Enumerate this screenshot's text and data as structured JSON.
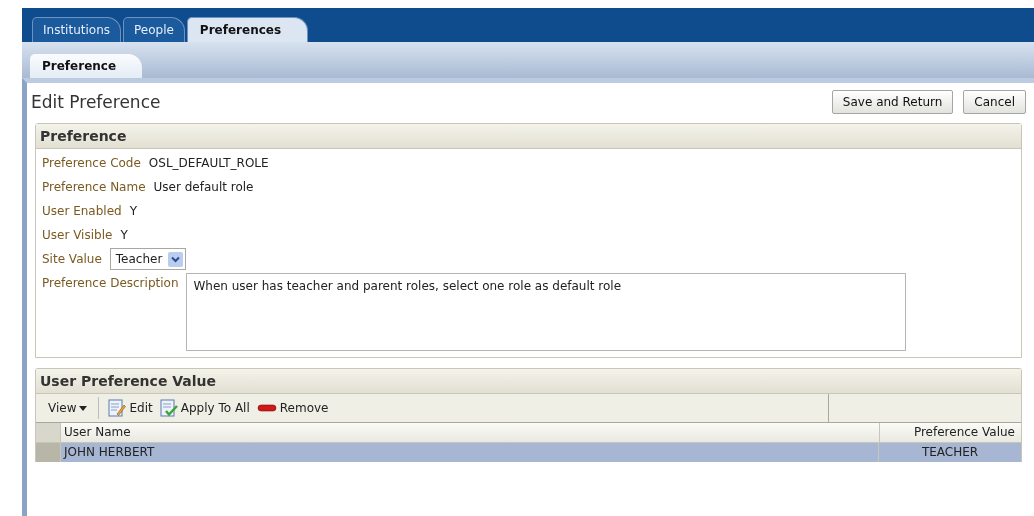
{
  "tabs": [
    {
      "label": "Institutions",
      "selected": false
    },
    {
      "label": "People",
      "selected": false
    },
    {
      "label": "Preferences",
      "selected": true
    }
  ],
  "subtabs": [
    {
      "label": "Preference",
      "selected": true
    }
  ],
  "page": {
    "title": "Edit Preference",
    "buttons": [
      "Save and Return",
      "Cancel"
    ]
  },
  "preference_panel": {
    "title": "Preference",
    "fields": [
      {
        "kind": "text",
        "label": "Preference Code",
        "value": "OSL_DEFAULT_ROLE"
      },
      {
        "kind": "text",
        "label": "Preference Name",
        "value": "User default role"
      },
      {
        "kind": "text",
        "label": "User Enabled",
        "value": "Y"
      },
      {
        "kind": "text",
        "label": "User Visible",
        "value": "Y"
      },
      {
        "kind": "select",
        "label": "Site Value",
        "value": "Teacher"
      },
      {
        "kind": "textarea",
        "label": "Preference Description",
        "value": "When user has teacher and parent roles, select one role as default role"
      }
    ]
  },
  "user_values_panel": {
    "title": "User Preference Value",
    "toolbar": {
      "view": "View",
      "actions": [
        {
          "kind": "edit",
          "label": "Edit"
        },
        {
          "kind": "apply",
          "label": "Apply To All"
        },
        {
          "kind": "remove",
          "label": "Remove"
        }
      ]
    },
    "table": {
      "columns": [
        "User Name",
        "Preference Value"
      ],
      "rows": [
        {
          "cells": [
            "JOHN HERBERT",
            "TEACHER"
          ],
          "selected": true
        }
      ]
    }
  }
}
